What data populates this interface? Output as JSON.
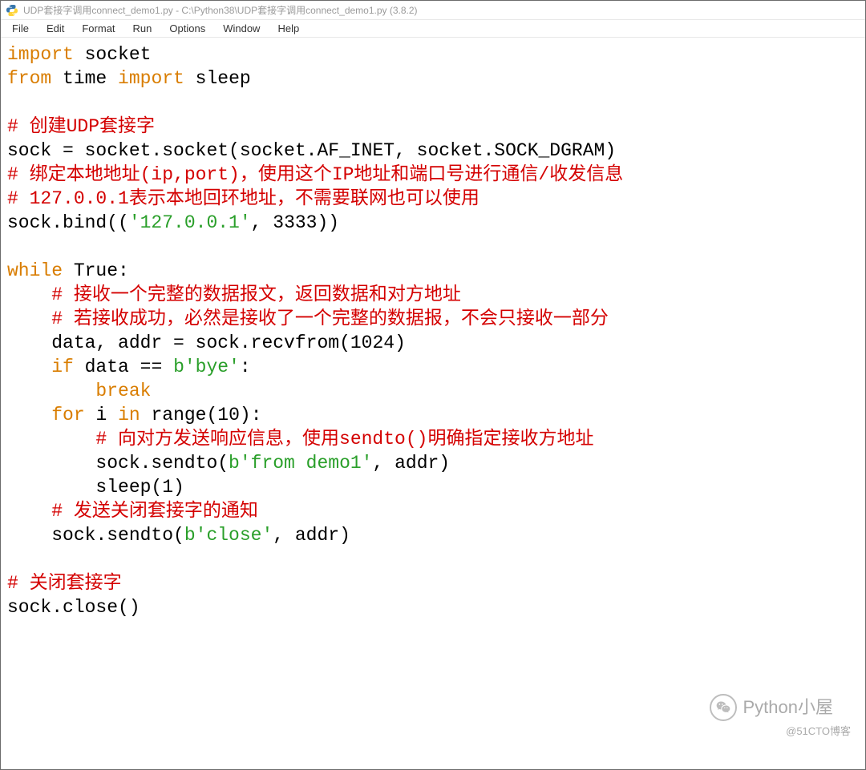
{
  "title": "UDP套接字调用connect_demo1.py - C:\\Python38\\UDP套接字调用connect_demo1.py (3.8.2)",
  "menu": {
    "file": "File",
    "edit": "Edit",
    "format": "Format",
    "run": "Run",
    "options": "Options",
    "window": "Window",
    "help": "Help"
  },
  "code": {
    "l01a": "import",
    "l01b": " socket",
    "l02a": "from",
    "l02b": " time ",
    "l02c": "import",
    "l02d": " sleep",
    "l03": "",
    "l04": "# 创建UDP套接字",
    "l05a": "sock = socket.socket(socket.AF_INET, socket.SOCK_DGRAM)",
    "l06": "# 绑定本地地址(ip,port)，使用这个IP地址和端口号进行通信/收发信息",
    "l07": "# 127.0.0.1表示本地回环地址，不需要联网也可以使用",
    "l08a": "sock.bind((",
    "l08b": "'127.0.0.1'",
    "l08c": ", 3333))",
    "l09": "",
    "l10a": "while",
    "l10b": " True:",
    "l11": "    # 接收一个完整的数据报文，返回数据和对方地址",
    "l12": "    # 若接收成功，必然是接收了一个完整的数据报，不会只接收一部分",
    "l13a": "    data, addr = sock.recvfrom(1024)",
    "l14a": "    ",
    "l14b": "if",
    "l14c": " data == ",
    "l14d": "b'bye'",
    "l14e": ":",
    "l15a": "        ",
    "l15b": "break",
    "l16a": "    ",
    "l16b": "for",
    "l16c": " i ",
    "l16d": "in",
    "l16e": " range(10):",
    "l17a": "        ",
    "l17b": "# 向对方发送响应信息，使用sendto()明确指定接收方地址",
    "l18a": "        sock.sendto(",
    "l18b": "b'from demo1'",
    "l18c": ", addr)",
    "l19a": "        sleep(1)",
    "l20": "    # 发送关闭套接字的通知",
    "l21a": "    sock.sendto(",
    "l21b": "b'close'",
    "l21c": ", addr)",
    "l22": "",
    "l23": "# 关闭套接字",
    "l24": "sock.close()"
  },
  "watermark": {
    "brand": "Python小屋",
    "site": "@51CTO博客"
  }
}
